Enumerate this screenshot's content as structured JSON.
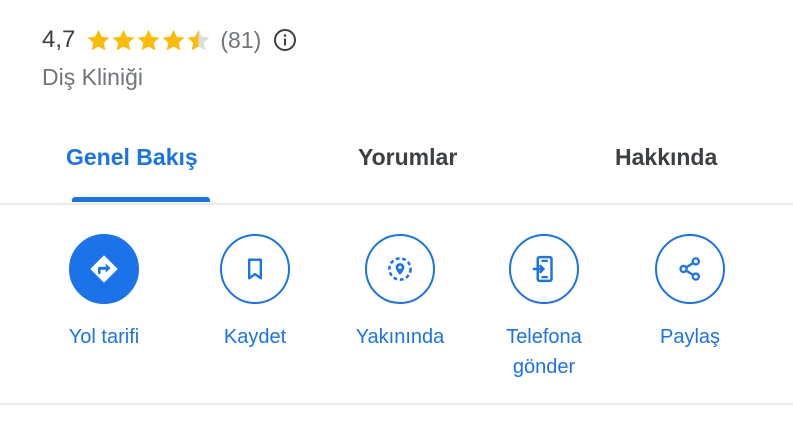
{
  "place": {
    "rating": "4,7",
    "stars": 4.5,
    "review_count": "(81)",
    "category": "Diş Kliniği"
  },
  "tabs": [
    {
      "label": "Genel Bakış",
      "active": true
    },
    {
      "label": "Yorumlar",
      "active": false
    },
    {
      "label": "Hakkında",
      "active": false
    }
  ],
  "actions": [
    {
      "label": "Yol tarifi",
      "icon": "directions-icon"
    },
    {
      "label": "Kaydet",
      "icon": "bookmark-icon"
    },
    {
      "label": "Yakınında",
      "icon": "nearby-icon"
    },
    {
      "label": "Telefona gönder",
      "icon": "send-to-phone-icon"
    },
    {
      "label": "Paylaş",
      "icon": "share-icon"
    }
  ],
  "colors": {
    "accent": "#1a73e8",
    "star": "#fbbc04",
    "text_primary": "#3c4043",
    "text_secondary": "#70757a",
    "divider": "#e8eaed"
  }
}
